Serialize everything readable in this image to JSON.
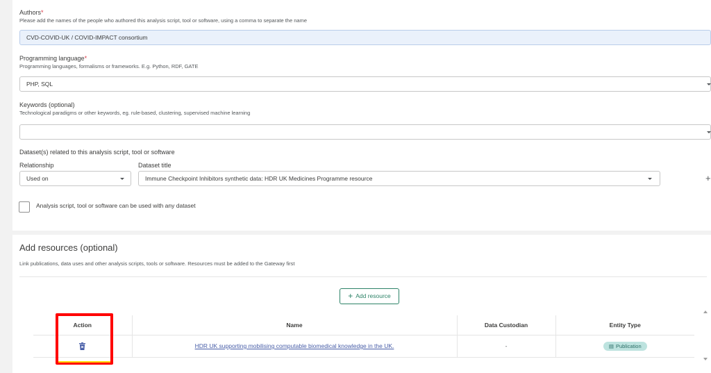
{
  "authors": {
    "label": "Authors",
    "required_mark": "*",
    "hint": "Please add the names of the people who authored this analysis script, tool or software, using a comma to separate the name",
    "value": "CVD-COVID-UK / COVID-IMPACT consortium"
  },
  "programming_language": {
    "label": "Programming language",
    "required_mark": "*",
    "hint": "Programming languages, formalisms or frameworks. E.g. Python, RDF, GATE",
    "value": "PHP, SQL"
  },
  "keywords": {
    "label": "Keywords (optional)",
    "hint": "Technological paradigms or other keywords, eg. rule-based, clustering, supervised machine learning",
    "value": ""
  },
  "datasets": {
    "label": "Dataset(s) related to this analysis script, tool or software",
    "relationship_label": "Relationship",
    "relationship_value": "Used on",
    "title_label": "Dataset title",
    "title_value": "Immune Checkpoint Inhibitors synthetic data: HDR UK Medicines Programme resource",
    "add_symbol": "+",
    "any_dataset_label": "Analysis script, tool or software can be used with any dataset"
  },
  "resources": {
    "title": "Add resources (optional)",
    "hint": "Link publications, data uses and other analysis scripts, tools or software. Resources must be added to the Gateway first",
    "add_button_symbol": "+",
    "add_button_label": "Add resource",
    "table": {
      "headers": [
        "Action",
        "Name",
        "Data Custodian",
        "Entity Type"
      ],
      "rows": [
        {
          "action_icon": "trash-icon",
          "name": "HDR UK supporting mobilising computable biomedical knowledge in the UK.",
          "custodian": "-",
          "entity_type": "Publication"
        }
      ]
    }
  },
  "colors": {
    "accent_green": "#2c8267",
    "link_blue": "#475da7",
    "required_red": "#dc3645",
    "highlight_red": "#ff0000",
    "badge_bg": "#bde3df"
  }
}
